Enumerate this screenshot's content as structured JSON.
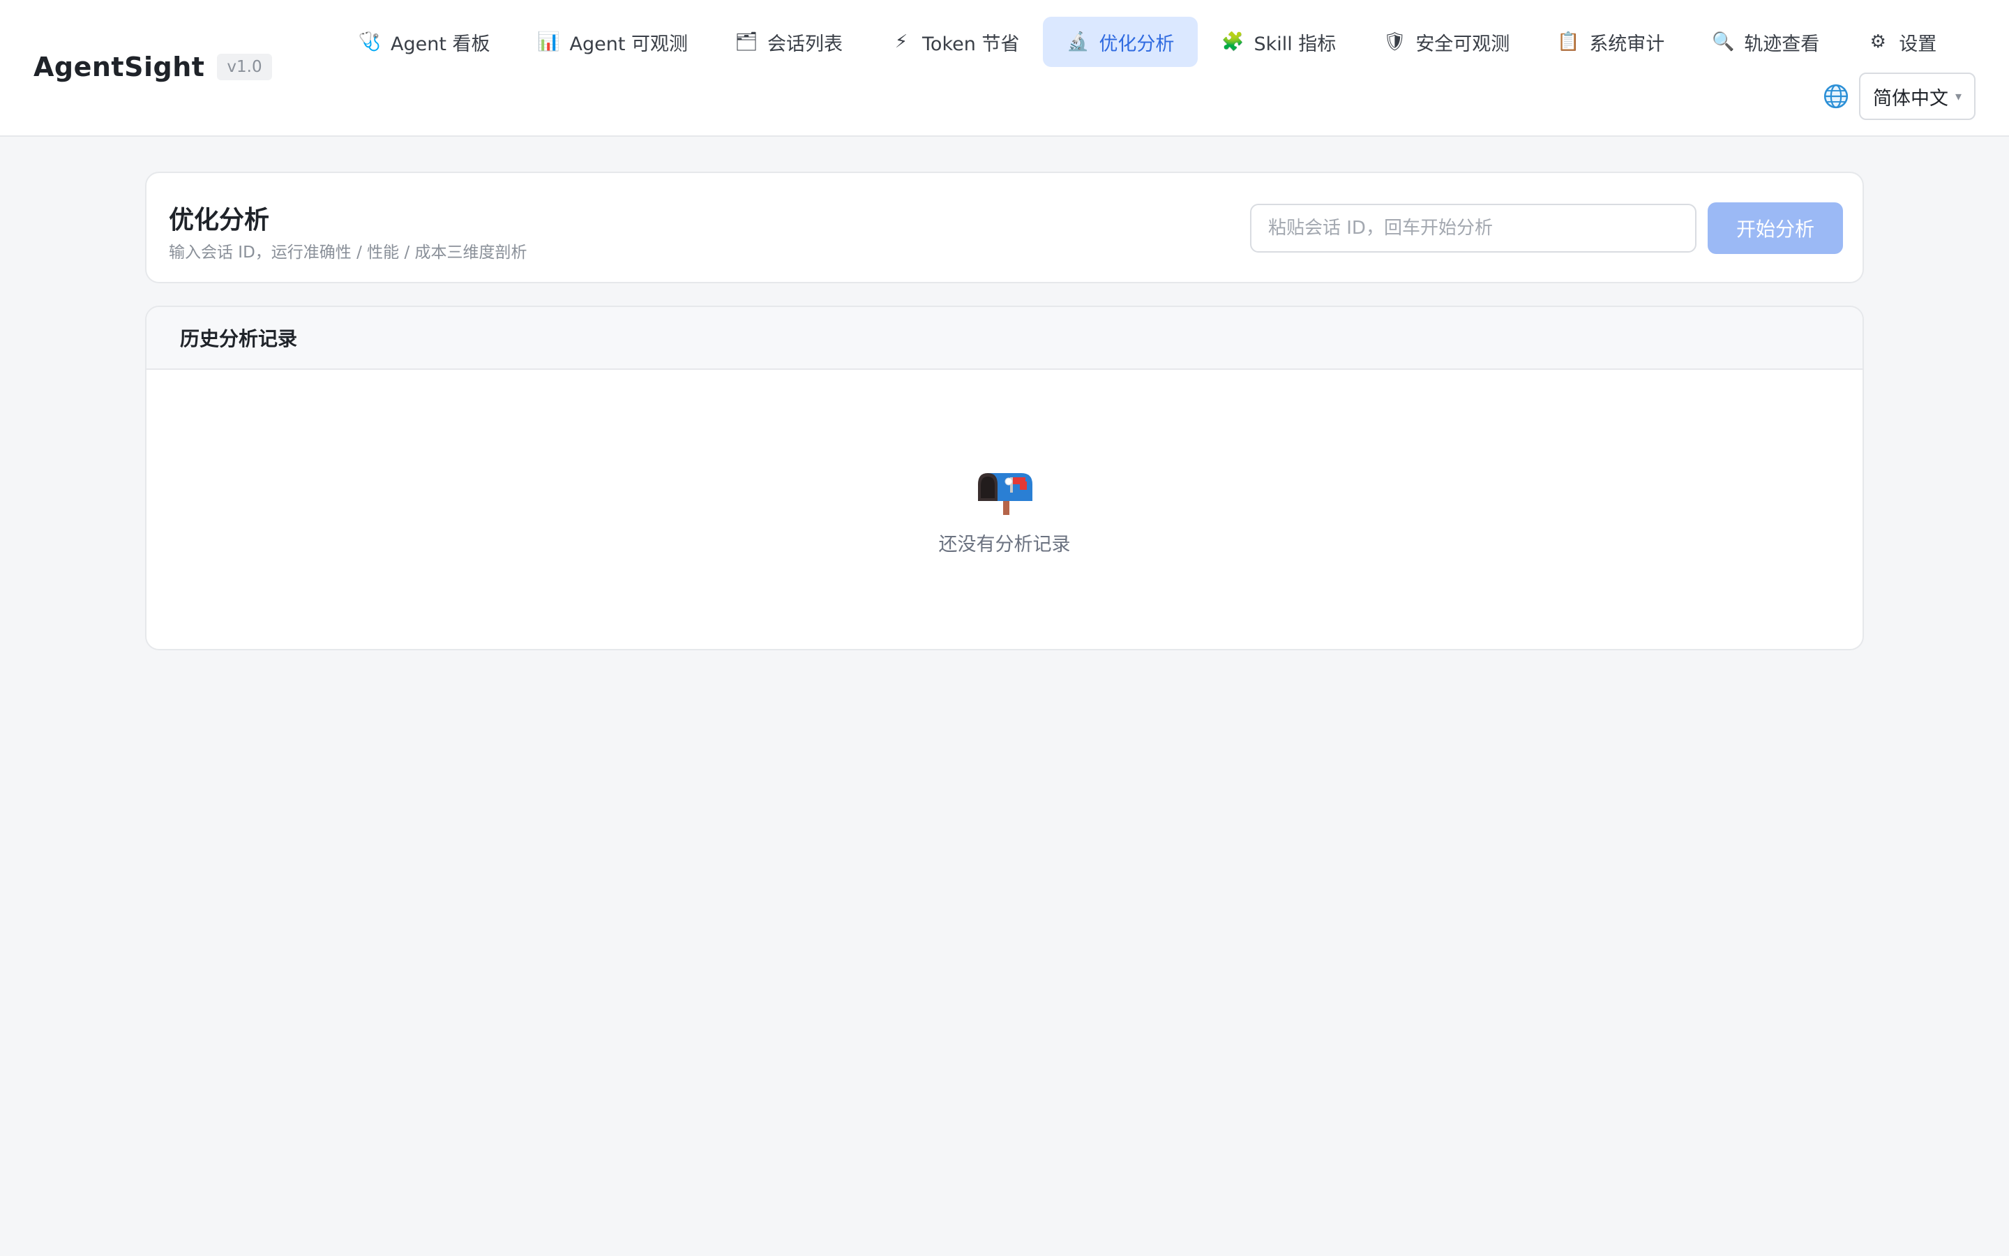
{
  "brand": {
    "name": "AgentSight",
    "version": "v1.0"
  },
  "nav": [
    {
      "icon": "stethoscope-icon",
      "glyph": "🩺",
      "label": "Agent 看板",
      "active": false
    },
    {
      "icon": "bar-chart-icon",
      "glyph": "📊",
      "label": "Agent 可观测",
      "active": false
    },
    {
      "icon": "folder-icon",
      "glyph": "🗂",
      "label": "会话列表",
      "active": false
    },
    {
      "icon": "lightning-icon",
      "glyph": "⚡",
      "label": "Token 节省",
      "active": false
    },
    {
      "icon": "microscope-icon",
      "glyph": "🔬",
      "label": "优化分析",
      "active": true
    },
    {
      "icon": "puzzle-icon",
      "glyph": "🧩",
      "label": "Skill 指标",
      "active": false
    },
    {
      "icon": "shield-icon",
      "glyph": "🛡",
      "label": "安全可观测",
      "active": false
    },
    {
      "icon": "clipboard-icon",
      "glyph": "📋",
      "label": "系统审计",
      "active": false
    },
    {
      "icon": "magnifier-icon",
      "glyph": "🔍",
      "label": "轨迹查看",
      "active": false
    },
    {
      "icon": "gear-icon",
      "glyph": "⚙",
      "label": "设置",
      "active": false
    }
  ],
  "language": {
    "icon": "globe-icon",
    "selected": "简体中文"
  },
  "page": {
    "title": "优化分析",
    "subtitle": "输入会话 ID，运行准确性 / 性能 / 成本三维度剖析",
    "input_placeholder": "粘贴会话 ID，回车开始分析",
    "input_value": "",
    "start_label": "开始分析"
  },
  "history": {
    "title": "历史分析记录",
    "empty_icon": "mailbox-icon",
    "empty_text": "还没有分析记录"
  },
  "colors": {
    "accent": "#2f6ae0",
    "active_tab_bg": "#dbe8ff",
    "button_disabled": "#9bb9f5",
    "page_bg": "#f5f6f8"
  }
}
